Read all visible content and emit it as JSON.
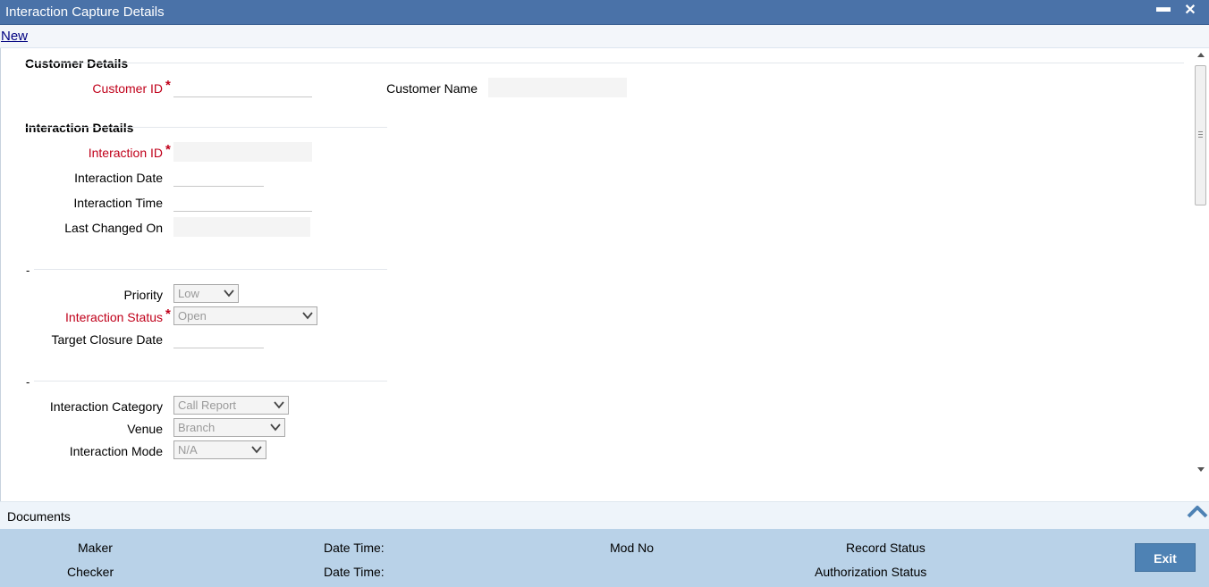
{
  "window": {
    "title": "Interaction Capture Details",
    "minimize_glyph": "▬",
    "close_glyph": "✕"
  },
  "toolbar": {
    "new_label": "New"
  },
  "customer_details": {
    "section_title": "Customer Details",
    "customer_id_label": "Customer ID",
    "customer_id_value": "",
    "customer_name_label": "Customer Name",
    "customer_name_value": ""
  },
  "interaction_details": {
    "section_title": "Interaction Details",
    "interaction_id_label": "Interaction ID",
    "interaction_id_value": "",
    "interaction_date_label": "Interaction Date",
    "interaction_date_value": "",
    "interaction_time_label": "Interaction Time",
    "interaction_time_value": "",
    "last_changed_on_label": "Last Changed On",
    "last_changed_on_value": ""
  },
  "status_section": {
    "title": "-",
    "priority_label": "Priority",
    "priority_value": "Low",
    "interaction_status_label": "Interaction Status",
    "interaction_status_value": "Open",
    "target_closure_date_label": "Target Closure Date",
    "target_closure_date_value": ""
  },
  "category_section": {
    "title": "-",
    "interaction_category_label": "Interaction Category",
    "interaction_category_value": "Call Report",
    "venue_label": "Venue",
    "venue_value": "Branch",
    "interaction_mode_label": "Interaction Mode",
    "interaction_mode_value": "N/A"
  },
  "required_marker": "*",
  "documents": {
    "label": "Documents"
  },
  "footer": {
    "maker_label": "Maker",
    "checker_label": "Checker",
    "date_time_label_1": "Date Time:",
    "date_time_label_2": "Date Time:",
    "mod_no_label": "Mod No",
    "record_status_label": "Record Status",
    "authorization_status_label": "Authorization Status",
    "exit_label": "Exit"
  },
  "colors": {
    "titlebar": "#4a72a8",
    "required_label": "#c0001a",
    "footer": "#b9d2e8",
    "exit_button": "#4e82b4"
  },
  "icons": {
    "minimize": "minimize-icon",
    "close": "close-icon",
    "dropdown": "chevron-down-icon",
    "collapse": "chevron-up-icon"
  }
}
